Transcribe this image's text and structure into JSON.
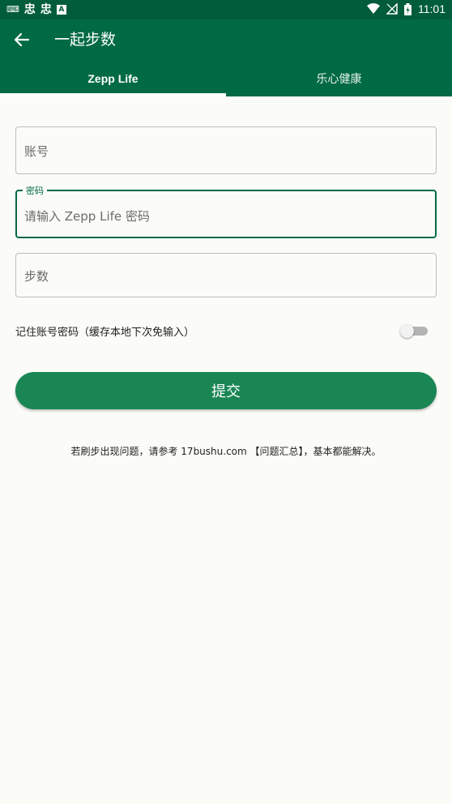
{
  "status_bar": {
    "left_icons": [
      "keyboard-icon",
      "app-icon",
      "app-icon",
      "a-icon"
    ],
    "right_icons": [
      "wifi-icon",
      "no-signal-icon",
      "battery-icon"
    ],
    "time": "11:01"
  },
  "app_bar": {
    "title": "一起步数",
    "back_icon": "arrow-back-icon"
  },
  "tabs": [
    {
      "label": "Zepp Life",
      "selected": true
    },
    {
      "label": "乐心健康",
      "selected": false
    }
  ],
  "form": {
    "account_placeholder": "账号",
    "password_label": "密码",
    "password_placeholder": "请输入 Zepp Life 密码",
    "steps_placeholder": "步数",
    "remember_label": "记住账号密码（缓存本地下次免输入）",
    "remember_on": false,
    "submit_label": "提交"
  },
  "footnote": "若刷步出现问题，请参考 17bushu.com 【问题汇总】，基本都能解决。",
  "colors": {
    "primary": "#006a44",
    "button": "#1a8654",
    "background": "#fbfcf8"
  }
}
